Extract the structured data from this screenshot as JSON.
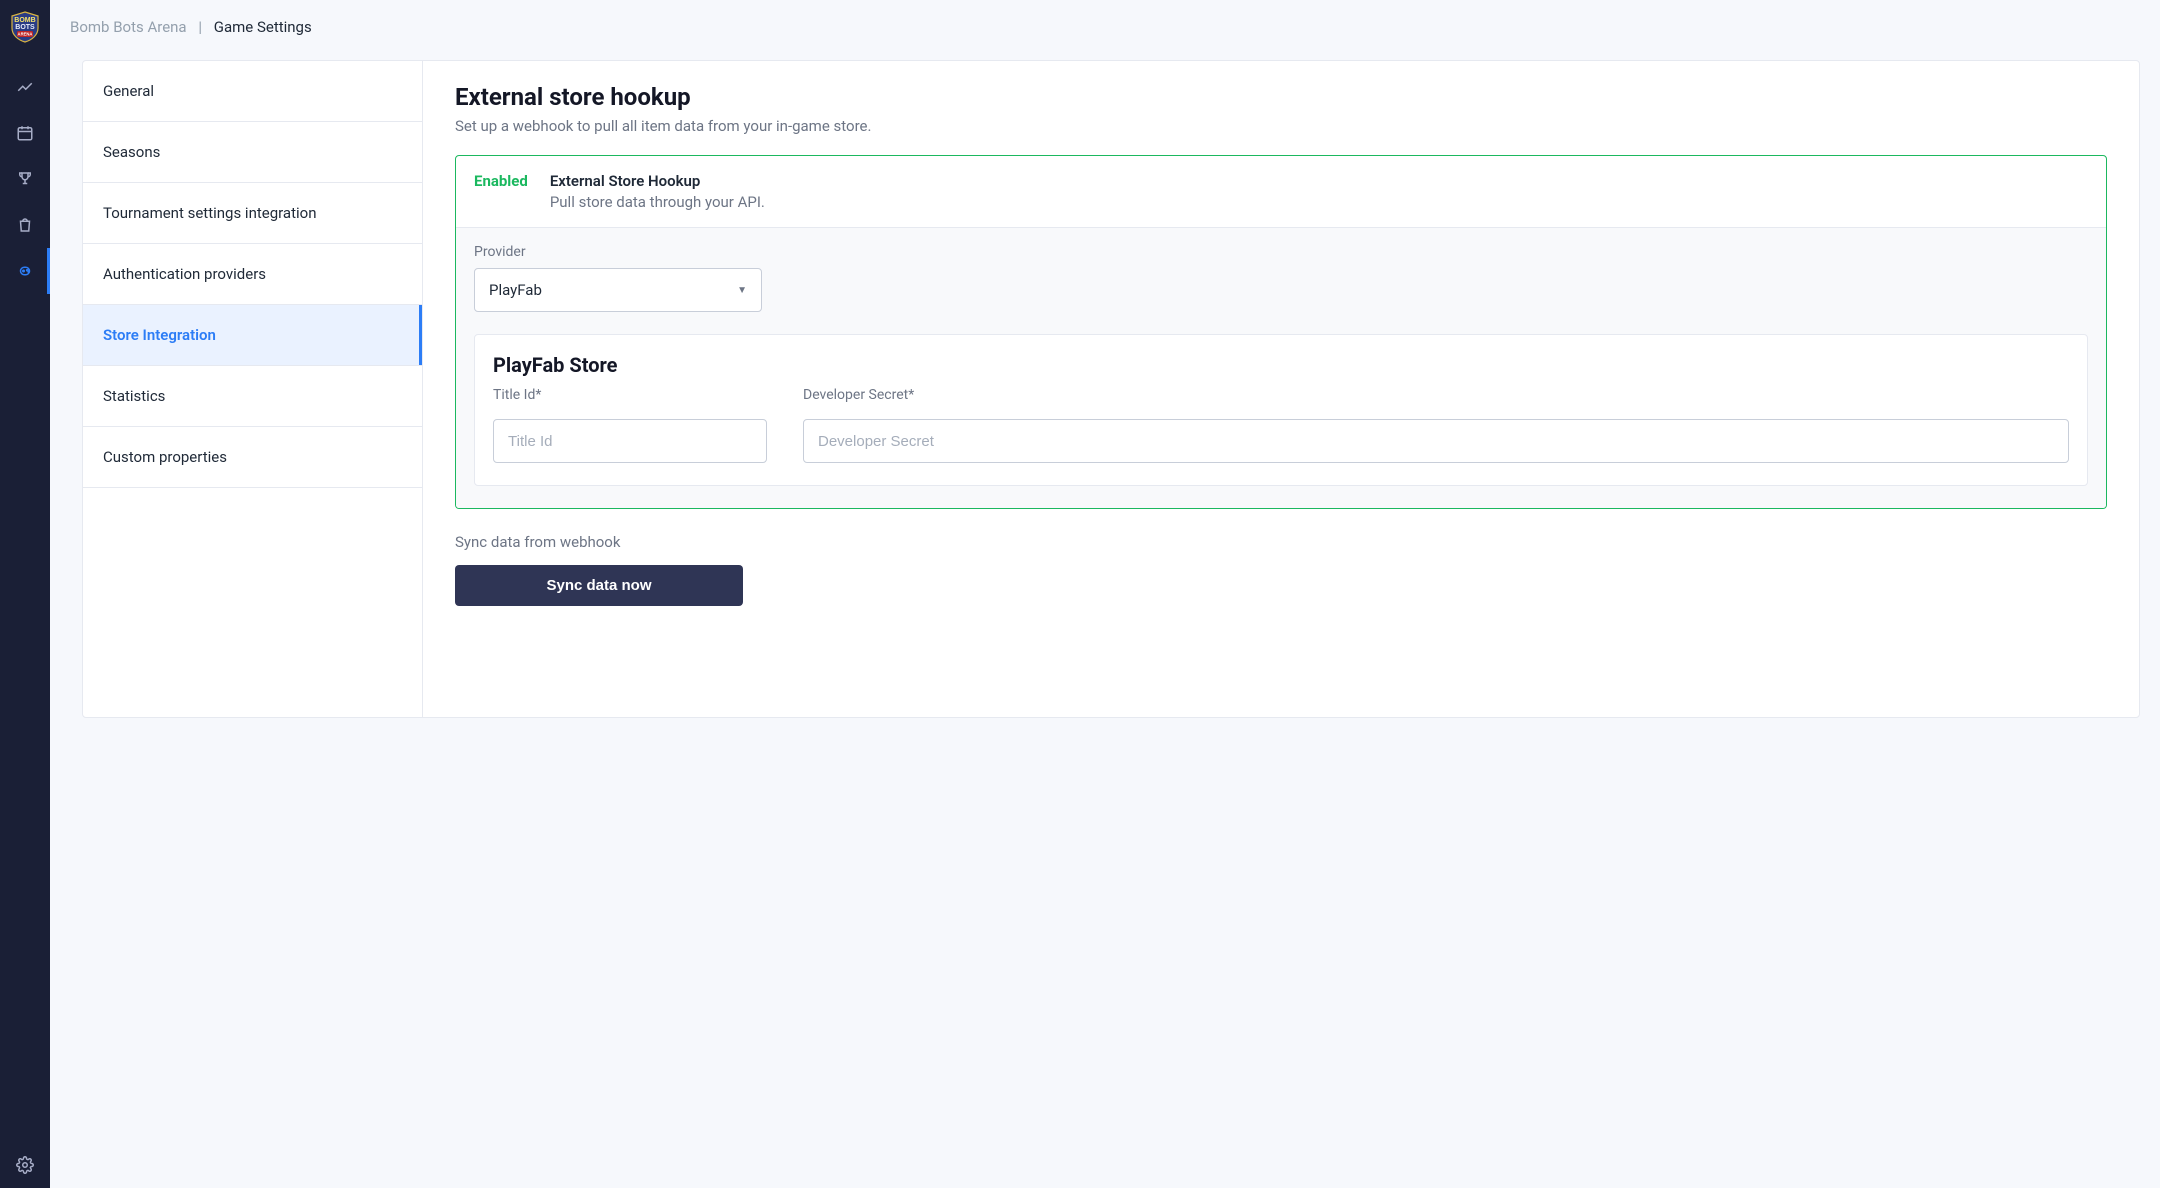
{
  "breadcrumbs": {
    "root": "Bomb Bots Arena",
    "current": "Game Settings"
  },
  "sidebar": {
    "items": [
      {
        "label": "General"
      },
      {
        "label": "Seasons"
      },
      {
        "label": "Tournament settings integration"
      },
      {
        "label": "Authentication providers"
      },
      {
        "label": "Store Integration"
      },
      {
        "label": "Statistics"
      },
      {
        "label": "Custom properties"
      }
    ]
  },
  "page": {
    "title": "External store hookup",
    "subtitle": "Set up a webhook to pull all item data from your in-game store."
  },
  "panel": {
    "status": "Enabled",
    "title": "External Store Hookup",
    "desc": "Pull store data through your API.",
    "provider_label": "Provider",
    "provider_value": "PlayFab"
  },
  "store_card": {
    "title": "PlayFab Store",
    "title_id_label": "Title Id*",
    "title_id_placeholder": "Title Id",
    "secret_label": "Developer Secret*",
    "secret_placeholder": "Developer Secret"
  },
  "sync": {
    "label": "Sync data from webhook",
    "button": "Sync data now"
  }
}
